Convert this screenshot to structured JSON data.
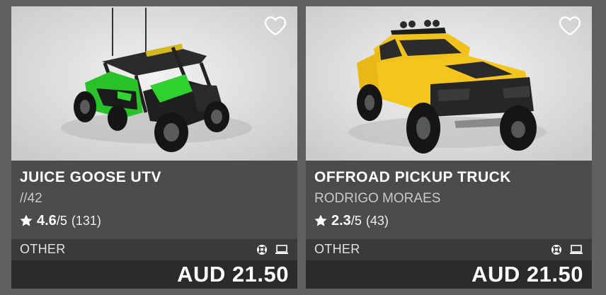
{
  "products": [
    {
      "title": "JUICE GOOSE UTV",
      "creator": "//42",
      "rating": {
        "score": "4.6",
        "out_of": "/5",
        "count": "(131)"
      },
      "category": "OTHER",
      "price": "AUD 21.50",
      "image": "green-utv-buggy",
      "platform_icons": [
        "xbox-icon",
        "pc-icon"
      ]
    },
    {
      "title": "OFFROAD PICKUP TRUCK",
      "creator": "RODRIGO MORAES",
      "rating": {
        "score": "2.3",
        "out_of": "/5",
        "count": "(43)"
      },
      "category": "OTHER",
      "price": "AUD 21.50",
      "image": "yellow-pickup-truck",
      "platform_icons": [
        "xbox-icon",
        "pc-icon"
      ]
    }
  ],
  "colors": {
    "background": "#5e6062",
    "info_panel": "#4b4b4c",
    "meta_bar": "#3a3a3b",
    "price_bar": "#2a2a2b",
    "text_primary": "#ffffff",
    "text_secondary": "#c9c9c9"
  }
}
